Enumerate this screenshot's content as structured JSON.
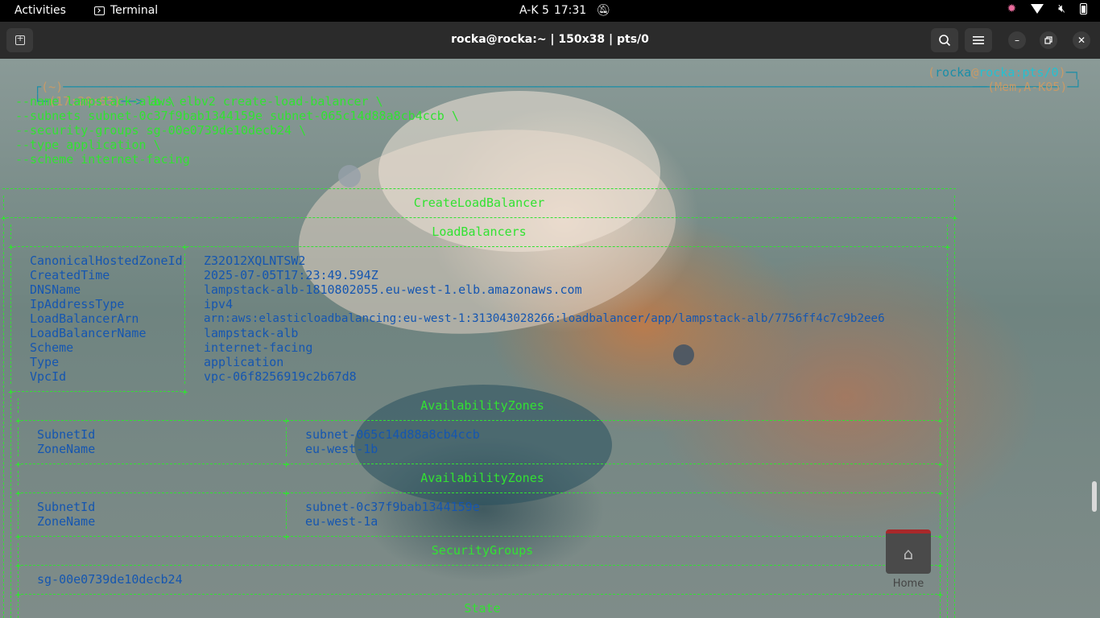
{
  "topbar": {
    "activities": "Activities",
    "app_name": "Terminal",
    "keyboard_layout": "A-K 5",
    "time": "17:31"
  },
  "header": {
    "title": "rocka@rocka:~ | 150x38 | pts/0"
  },
  "prompt": {
    "cwd": "(~)",
    "timestamp": "(17:20:05)",
    "arrow": "──>",
    "command": "aws elbv2 create-load-balancer \\",
    "args": [
      "--name lampstack-alb \\",
      "--subnets subnet-0c37f9bab1344159e subnet-065c14d88a8cb4ccb \\",
      "--security-groups sg-00e0739de10decb24 \\",
      "--type application \\",
      "--scheme internet-facing"
    ],
    "user": "rocka",
    "at": "@",
    "host": "rocka:pts/0",
    "mem": "(Mem,A-K05)"
  },
  "output": {
    "title": "CreateLoadBalancer",
    "lb_section": "LoadBalancers",
    "lb_rows": [
      {
        "key": "CanonicalHostedZoneId",
        "value": "Z32O12XQLNTSW2"
      },
      {
        "key": "CreatedTime",
        "value": "2025-07-05T17:23:49.594Z"
      },
      {
        "key": "DNSName",
        "value": "lampstack-alb-1810802055.eu-west-1.elb.amazonaws.com"
      },
      {
        "key": "IpAddressType",
        "value": "ipv4"
      },
      {
        "key": "LoadBalancerArn",
        "value": "arn:aws:elasticloadbalancing:eu-west-1:313043028266:loadbalancer/app/lampstack-alb/7756ff4c7c9b2ee6"
      },
      {
        "key": "LoadBalancerName",
        "value": "lampstack-alb"
      },
      {
        "key": "Scheme",
        "value": "internet-facing"
      },
      {
        "key": "Type",
        "value": "application"
      },
      {
        "key": "VpcId",
        "value": "vpc-06f8256919c2b67d8"
      }
    ],
    "az1": {
      "title": "AvailabilityZones",
      "subnet_key": "SubnetId",
      "subnet": "subnet-065c14d88a8cb4ccb",
      "zone_key": "ZoneName",
      "zone": "eu-west-1b"
    },
    "az2": {
      "title": "AvailabilityZones",
      "subnet_key": "SubnetId",
      "subnet": "subnet-0c37f9bab1344159e",
      "zone_key": "ZoneName",
      "zone": "eu-west-1a"
    },
    "sg_title": "SecurityGroups",
    "sg": "sg-00e0739de10decb24",
    "state_title": "State"
  },
  "desktop": {
    "home_label": "Home",
    "home_icon": "home-folder-icon"
  }
}
